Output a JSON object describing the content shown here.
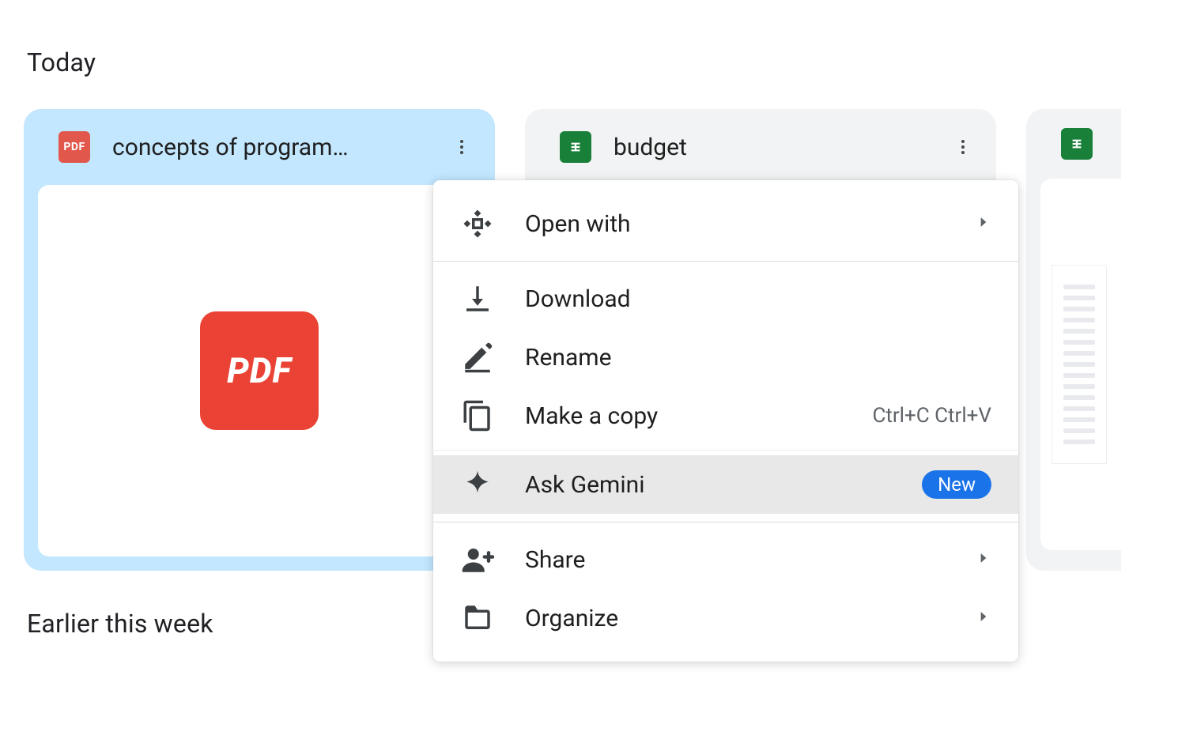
{
  "sections": {
    "today": "Today",
    "earlier": "Earlier this week"
  },
  "files": [
    {
      "title": "concepts of program…",
      "type": "pdf"
    },
    {
      "title": "budget",
      "type": "sheet"
    },
    {
      "title": "",
      "type": "sheet"
    }
  ],
  "menu": {
    "open_with": "Open with",
    "download": "Download",
    "rename": "Rename",
    "make_copy": "Make a copy",
    "make_copy_shortcut": "Ctrl+C Ctrl+V",
    "ask_gemini": "Ask Gemini",
    "ask_gemini_badge": "New",
    "share": "Share",
    "organize": "Organize"
  }
}
